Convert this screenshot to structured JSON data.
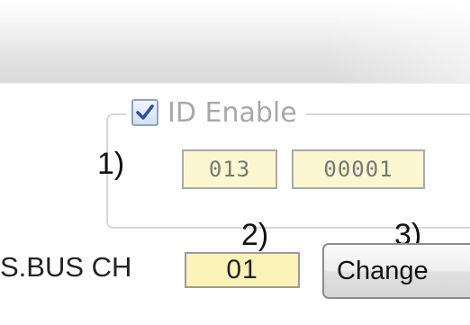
{
  "id_group": {
    "enable_label": "ID Enable",
    "enabled": true,
    "annotation": "1)",
    "field_1": "013",
    "field_2": "00001"
  },
  "sbus": {
    "label": "S.BUS CH",
    "channel_annotation": "2)",
    "channel_value": "01",
    "button_annotation": "3)",
    "change_label": "Change"
  },
  "colors": {
    "field_background": "#fbf7d0",
    "disabled_text": "#a8a8a8",
    "checkbox_border": "#8aa3c8"
  }
}
